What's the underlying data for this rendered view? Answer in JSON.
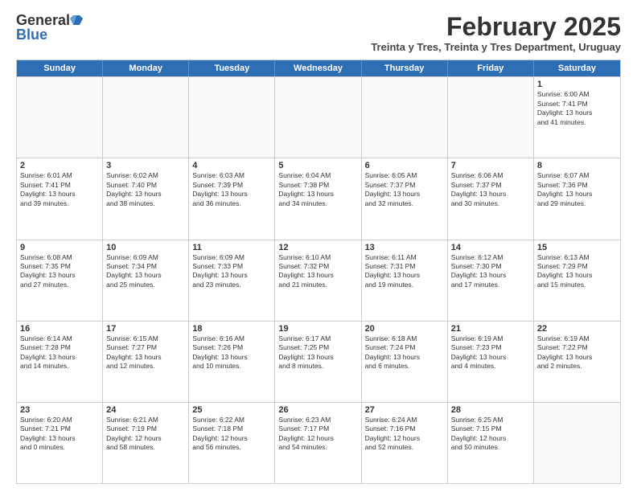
{
  "logo": {
    "general": "General",
    "blue": "Blue"
  },
  "header": {
    "month_year": "February 2025",
    "subtitle": "Treinta y Tres, Treinta y Tres Department, Uruguay"
  },
  "weekdays": [
    "Sunday",
    "Monday",
    "Tuesday",
    "Wednesday",
    "Thursday",
    "Friday",
    "Saturday"
  ],
  "weeks": [
    {
      "days": [
        {
          "num": "",
          "empty": true
        },
        {
          "num": "",
          "empty": true
        },
        {
          "num": "",
          "empty": true
        },
        {
          "num": "",
          "empty": true
        },
        {
          "num": "",
          "empty": true
        },
        {
          "num": "",
          "empty": true
        },
        {
          "num": "1",
          "info": "Sunrise: 6:00 AM\nSunset: 7:41 PM\nDaylight: 13 hours\nand 41 minutes."
        }
      ]
    },
    {
      "days": [
        {
          "num": "2",
          "info": "Sunrise: 6:01 AM\nSunset: 7:41 PM\nDaylight: 13 hours\nand 39 minutes."
        },
        {
          "num": "3",
          "info": "Sunrise: 6:02 AM\nSunset: 7:40 PM\nDaylight: 13 hours\nand 38 minutes."
        },
        {
          "num": "4",
          "info": "Sunrise: 6:03 AM\nSunset: 7:39 PM\nDaylight: 13 hours\nand 36 minutes."
        },
        {
          "num": "5",
          "info": "Sunrise: 6:04 AM\nSunset: 7:38 PM\nDaylight: 13 hours\nand 34 minutes."
        },
        {
          "num": "6",
          "info": "Sunrise: 6:05 AM\nSunset: 7:37 PM\nDaylight: 13 hours\nand 32 minutes."
        },
        {
          "num": "7",
          "info": "Sunrise: 6:06 AM\nSunset: 7:37 PM\nDaylight: 13 hours\nand 30 minutes."
        },
        {
          "num": "8",
          "info": "Sunrise: 6:07 AM\nSunset: 7:36 PM\nDaylight: 13 hours\nand 29 minutes."
        }
      ]
    },
    {
      "days": [
        {
          "num": "9",
          "info": "Sunrise: 6:08 AM\nSunset: 7:35 PM\nDaylight: 13 hours\nand 27 minutes."
        },
        {
          "num": "10",
          "info": "Sunrise: 6:09 AM\nSunset: 7:34 PM\nDaylight: 13 hours\nand 25 minutes."
        },
        {
          "num": "11",
          "info": "Sunrise: 6:09 AM\nSunset: 7:33 PM\nDaylight: 13 hours\nand 23 minutes."
        },
        {
          "num": "12",
          "info": "Sunrise: 6:10 AM\nSunset: 7:32 PM\nDaylight: 13 hours\nand 21 minutes."
        },
        {
          "num": "13",
          "info": "Sunrise: 6:11 AM\nSunset: 7:31 PM\nDaylight: 13 hours\nand 19 minutes."
        },
        {
          "num": "14",
          "info": "Sunrise: 6:12 AM\nSunset: 7:30 PM\nDaylight: 13 hours\nand 17 minutes."
        },
        {
          "num": "15",
          "info": "Sunrise: 6:13 AM\nSunset: 7:29 PM\nDaylight: 13 hours\nand 15 minutes."
        }
      ]
    },
    {
      "days": [
        {
          "num": "16",
          "info": "Sunrise: 6:14 AM\nSunset: 7:28 PM\nDaylight: 13 hours\nand 14 minutes."
        },
        {
          "num": "17",
          "info": "Sunrise: 6:15 AM\nSunset: 7:27 PM\nDaylight: 13 hours\nand 12 minutes."
        },
        {
          "num": "18",
          "info": "Sunrise: 6:16 AM\nSunset: 7:26 PM\nDaylight: 13 hours\nand 10 minutes."
        },
        {
          "num": "19",
          "info": "Sunrise: 6:17 AM\nSunset: 7:25 PM\nDaylight: 13 hours\nand 8 minutes."
        },
        {
          "num": "20",
          "info": "Sunrise: 6:18 AM\nSunset: 7:24 PM\nDaylight: 13 hours\nand 6 minutes."
        },
        {
          "num": "21",
          "info": "Sunrise: 6:19 AM\nSunset: 7:23 PM\nDaylight: 13 hours\nand 4 minutes."
        },
        {
          "num": "22",
          "info": "Sunrise: 6:19 AM\nSunset: 7:22 PM\nDaylight: 13 hours\nand 2 minutes."
        }
      ]
    },
    {
      "days": [
        {
          "num": "23",
          "info": "Sunrise: 6:20 AM\nSunset: 7:21 PM\nDaylight: 13 hours\nand 0 minutes."
        },
        {
          "num": "24",
          "info": "Sunrise: 6:21 AM\nSunset: 7:19 PM\nDaylight: 12 hours\nand 58 minutes."
        },
        {
          "num": "25",
          "info": "Sunrise: 6:22 AM\nSunset: 7:18 PM\nDaylight: 12 hours\nand 56 minutes."
        },
        {
          "num": "26",
          "info": "Sunrise: 6:23 AM\nSunset: 7:17 PM\nDaylight: 12 hours\nand 54 minutes."
        },
        {
          "num": "27",
          "info": "Sunrise: 6:24 AM\nSunset: 7:16 PM\nDaylight: 12 hours\nand 52 minutes."
        },
        {
          "num": "28",
          "info": "Sunrise: 6:25 AM\nSunset: 7:15 PM\nDaylight: 12 hours\nand 50 minutes."
        },
        {
          "num": "",
          "empty": true
        }
      ]
    }
  ]
}
